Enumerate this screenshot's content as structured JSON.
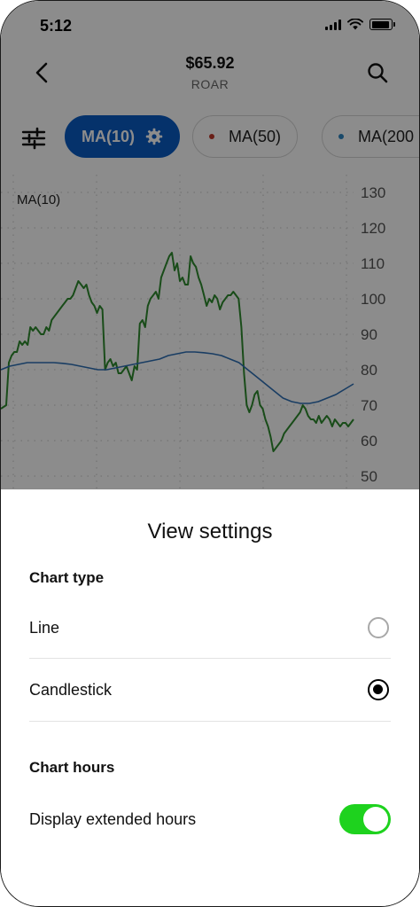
{
  "status_bar": {
    "time": "5:12"
  },
  "header": {
    "price": "$65.92",
    "ticker": "ROAR"
  },
  "chips": [
    {
      "label": "MA(10)",
      "active": true,
      "dot_color": ""
    },
    {
      "label": "MA(50)",
      "active": false,
      "dot_color": "#c0392b"
    },
    {
      "label": "MA(200",
      "active": false,
      "dot_color": "#2e86c1"
    }
  ],
  "chart_data": {
    "type": "line",
    "title": "MA(10)",
    "ylim": [
      45,
      135
    ],
    "yticks": [
      "130",
      "120",
      "110",
      "100",
      "90",
      "80",
      "70",
      "60",
      "50"
    ],
    "grid": true,
    "series": [
      {
        "name": "MA(10)",
        "color": "#2e8b2e",
        "values": [
          69,
          69.5,
          70,
          82,
          84,
          85,
          85,
          88,
          87,
          88,
          87,
          92,
          91,
          92,
          91,
          90,
          90,
          92,
          91,
          94,
          95,
          96,
          97,
          98,
          99,
          100,
          100,
          101,
          103,
          105,
          104,
          103,
          104,
          101,
          99,
          98,
          96,
          98,
          97,
          80,
          82,
          83,
          81,
          82,
          79,
          79,
          80,
          81,
          79,
          77,
          81,
          80,
          93,
          94,
          92,
          98,
          100,
          101,
          102,
          100,
          106,
          108,
          110,
          112,
          113,
          108,
          110,
          105,
          106,
          104,
          104,
          112,
          110,
          109,
          106,
          104,
          101,
          98,
          100,
          99,
          101,
          100,
          97,
          99,
          100,
          101,
          101,
          102,
          101,
          100,
          92,
          79,
          70,
          68,
          70,
          73,
          74,
          70,
          69,
          66,
          64,
          61,
          57,
          58,
          59,
          60,
          62,
          63,
          64,
          65,
          66,
          67,
          68,
          70,
          69,
          67,
          66,
          66,
          65,
          67,
          65,
          66,
          67,
          66,
          64,
          66,
          65,
          64,
          65,
          65,
          64,
          65,
          66
        ],
        "value_labels": []
      },
      {
        "name": "MA(50)",
        "color": "#2e6fb5",
        "values": [
          80,
          81,
          81.5,
          82,
          82,
          82,
          82,
          81.8,
          81.5,
          81,
          80.5,
          80,
          80,
          80.5,
          81,
          81.5,
          82,
          82.5,
          83,
          84,
          84.5,
          85,
          85,
          84.8,
          84.5,
          84,
          83,
          82,
          80,
          78,
          76,
          74,
          72,
          71,
          70.5,
          70.5,
          71,
          72,
          73,
          74.5,
          76
        ]
      }
    ]
  },
  "sheet": {
    "title": "View settings",
    "chart_type_header": "Chart type",
    "options": [
      {
        "label": "Line",
        "checked": false
      },
      {
        "label": "Candlestick",
        "checked": true
      }
    ],
    "chart_hours_header": "Chart hours",
    "extended_hours_label": "Display extended hours",
    "extended_hours_on": true,
    "toggle_color": "#1ed21e"
  }
}
